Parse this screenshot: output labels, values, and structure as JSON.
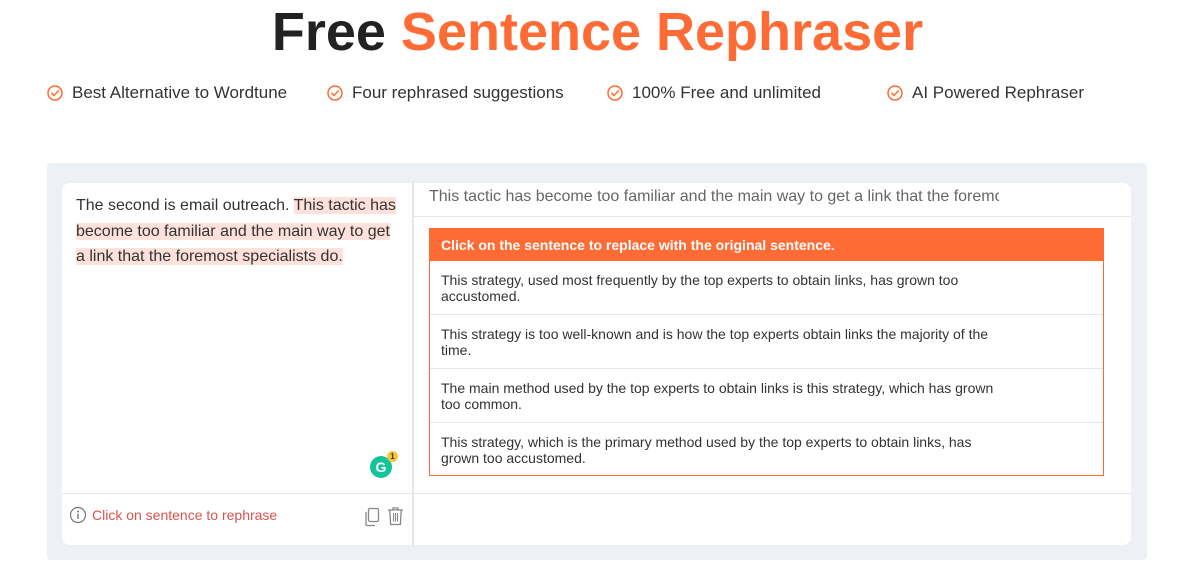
{
  "header": {
    "title_plain": "Free",
    "title_accent": "Sentence Rephraser"
  },
  "features": [
    {
      "label": "Best Alternative to Wordtune"
    },
    {
      "label": "Four rephrased suggestions"
    },
    {
      "label": "100% Free and unlimited"
    },
    {
      "label": "AI Powered Rephraser"
    }
  ],
  "editor": {
    "text_plain": "The second is email outreach. ",
    "text_highlighted": "This tactic has become too familiar and the main way to get a link that the foremost specialists do.",
    "grammarly_count": "1",
    "hint": "Click on sentence to rephrase"
  },
  "results": {
    "selected_sentence": "This tactic has become too familiar and the main way to get a link that the foremost specialists do.",
    "header": "Click on the sentence to replace with the original sentence.",
    "suggestions": [
      {
        "text": "This strategy, used most frequently by the top experts to obtain links, has grown too accustomed."
      },
      {
        "text": "This strategy is too well-known and is how the top experts obtain links the majority of the time."
      },
      {
        "text": "The main method used by the top experts to obtain links is this strategy, which has grown too common."
      },
      {
        "text": "This strategy, which is the primary method used by the top experts to obtain links, has grown too accustomed."
      }
    ]
  },
  "colors": {
    "accent": "#ff6b35",
    "panel_bg": "#edf1f5",
    "highlight": "#fde1da",
    "hint_text": "#d9534f",
    "grammarly": "#15c39a"
  },
  "icons": {
    "feature": "check-circle-icon",
    "hint": "info-icon",
    "copy": "copy-icon",
    "delete": "trash-icon",
    "grammarly": "grammarly-icon"
  }
}
